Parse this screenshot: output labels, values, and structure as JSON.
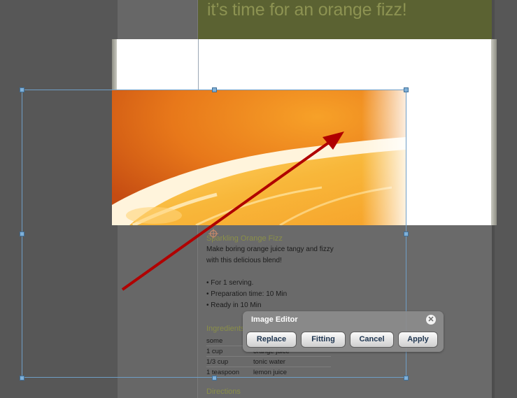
{
  "page": {
    "title": "it’s time for an orange fizz!"
  },
  "recipe": {
    "heading": "Sparkling Orange Fizz",
    "description": [
      "Make boring orange juice tangy and fizzy",
      "with this delicious blend!"
    ],
    "facts": [
      "• For 1 serving.",
      "• Preparation time: 10 Min",
      "• Ready in 10 Min"
    ],
    "ingredients_heading": "Ingredients",
    "ingredients": [
      {
        "qty": "some",
        "name": ""
      },
      {
        "qty": "1 cup",
        "name": "orange juice"
      },
      {
        "qty": "1/3 cup",
        "name": "tonic water"
      },
      {
        "qty": "1 teaspoon",
        "name": "lemon juice"
      }
    ],
    "directions_heading": "Directions"
  },
  "image_editor": {
    "title": "Image Editor",
    "close_symbol": "✕",
    "buttons": {
      "replace": "Replace",
      "fitting": "Fitting",
      "cancel": "Cancel",
      "apply": "Apply"
    }
  },
  "colors": {
    "title_band": "#5b6232",
    "accent_text": "#8a8f48",
    "selection": "#6f9ec6",
    "arrow": "#c00000"
  },
  "icons": {
    "close": "close-icon",
    "crosshair": "crosshair-icon",
    "arrow": "annotation-arrow"
  }
}
